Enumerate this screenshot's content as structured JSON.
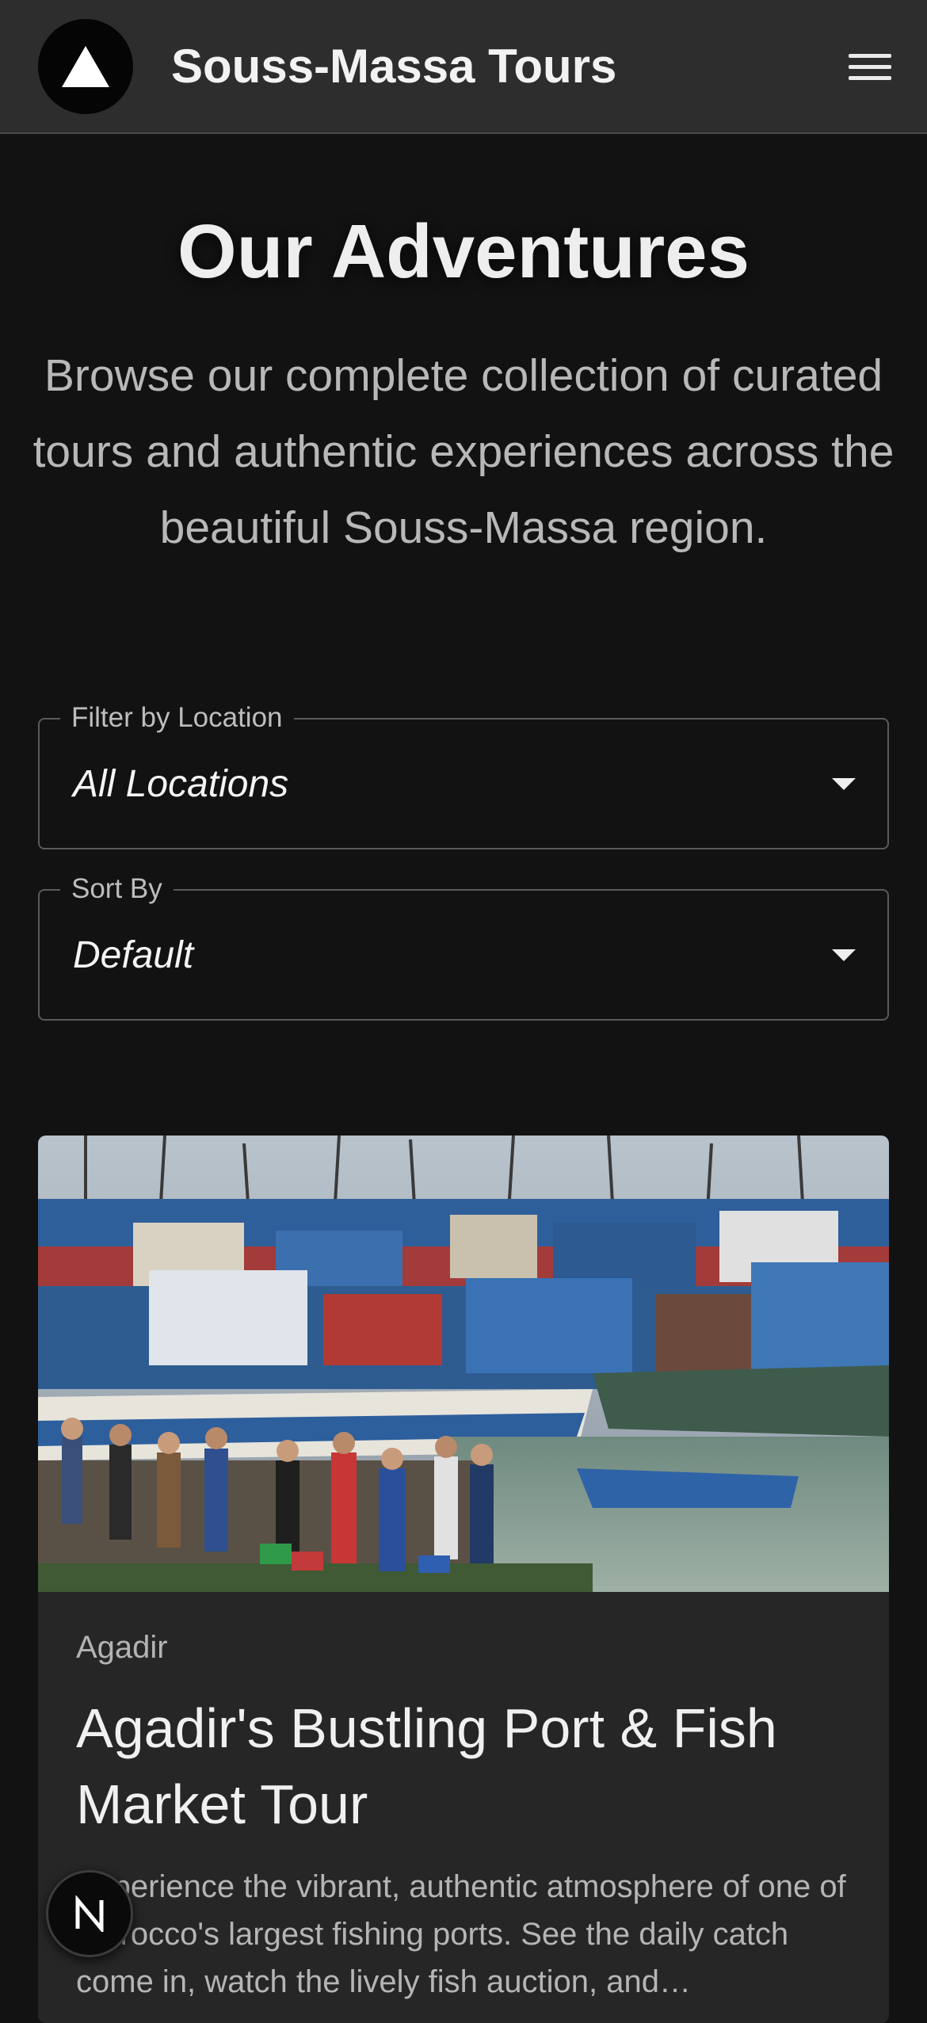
{
  "header": {
    "brand": "Souss-Massa Tours",
    "logo_icon": "triangle-logo-icon",
    "menu_icon": "hamburger-menu-icon"
  },
  "hero": {
    "title": "Our Adventures",
    "intro": "Browse our complete collection of curated tours and authentic experiences across the beautiful Souss-Massa region."
  },
  "filters": {
    "location": {
      "label": "Filter by Location",
      "value": "All Locations"
    },
    "sort": {
      "label": "Sort By",
      "value": "Default"
    }
  },
  "tours": [
    {
      "location": "Agadir",
      "title": "Agadir's Bustling Port & Fish Market Tour",
      "description": "Experience the vibrant, authentic atmosphere of one of Morocco's largest fishing ports. See the daily catch come in, watch the lively fish auction, and…",
      "image_icon": "fishing-port-photo"
    }
  ],
  "floating_badge": {
    "letter": "N",
    "icon": "n-badge-icon"
  },
  "colors": {
    "background": "#121212",
    "app_bar": "#2d2d2d",
    "card": "#262626",
    "text_primary": "#ececec",
    "text_secondary": "#b8b8b8"
  }
}
